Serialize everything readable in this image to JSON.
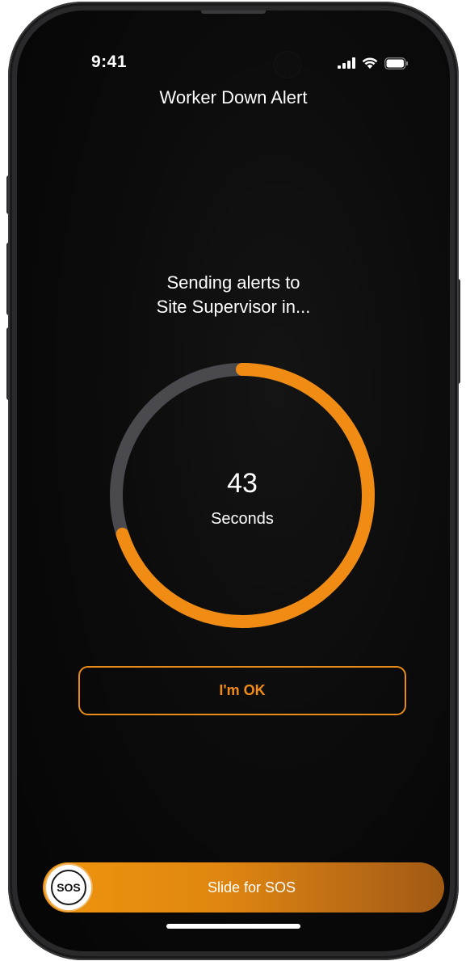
{
  "status_bar": {
    "time": "9:41",
    "icons": [
      "cellular-signal-icon",
      "wifi-icon",
      "battery-icon"
    ]
  },
  "header": {
    "title": "Worker Down Alert"
  },
  "countdown": {
    "message_line1": "Sending alerts to",
    "message_line2": "Site Supervisor in...",
    "value": "43",
    "unit": "Seconds",
    "remaining_fraction": 0.7
  },
  "actions": {
    "ok_label": "I'm OK"
  },
  "sos_slider": {
    "knob_label": "SOS",
    "label": "Slide for SOS"
  },
  "colors": {
    "accent": "#F08C13",
    "ring_track": "#4A4A4E",
    "background": "#0A0A0A"
  }
}
